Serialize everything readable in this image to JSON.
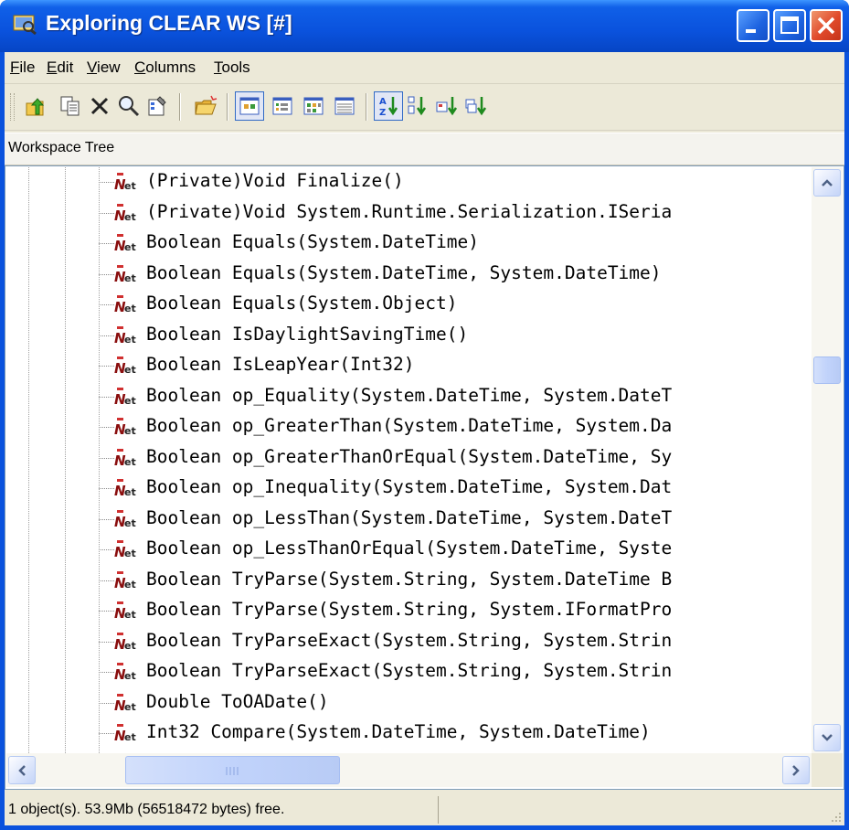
{
  "window": {
    "title": "Exploring CLEAR WS [#]"
  },
  "menu": [
    {
      "label": "File",
      "mnemonic": "F"
    },
    {
      "label": "Edit",
      "mnemonic": "E"
    },
    {
      "label": "View",
      "mnemonic": "V"
    },
    {
      "label": "Columns",
      "mnemonic": "C"
    },
    {
      "label": "Tools",
      "mnemonic": "T"
    }
  ],
  "toolbar": {
    "buttons": [
      {
        "name": "up-folder-icon"
      },
      {
        "name": "copy-icon"
      },
      {
        "name": "delete-icon"
      },
      {
        "name": "find-icon"
      },
      {
        "name": "properties-icon"
      },
      {
        "name": "open-folder-icon"
      },
      {
        "name": "large-icons-view-icon",
        "pressed": true
      },
      {
        "name": "small-icons-view-icon"
      },
      {
        "name": "list-view-icon"
      },
      {
        "name": "details-view-icon"
      },
      {
        "name": "sort-az-icon",
        "pressed": true
      },
      {
        "name": "sort-type-icon"
      },
      {
        "name": "sort-size-icon"
      },
      {
        "name": "sort-date-icon"
      }
    ]
  },
  "panel": {
    "header": "Workspace Tree"
  },
  "tree": {
    "items": [
      {
        "label": "(Private)Void Finalize()"
      },
      {
        "label": "(Private)Void System.Runtime.Serialization.ISeria"
      },
      {
        "label": "Boolean Equals(System.DateTime)"
      },
      {
        "label": "Boolean Equals(System.DateTime, System.DateTime)"
      },
      {
        "label": "Boolean Equals(System.Object)"
      },
      {
        "label": "Boolean IsDaylightSavingTime()"
      },
      {
        "label": "Boolean IsLeapYear(Int32)"
      },
      {
        "label": "Boolean op_Equality(System.DateTime, System.DateT"
      },
      {
        "label": "Boolean op_GreaterThan(System.DateTime, System.Da"
      },
      {
        "label": "Boolean op_GreaterThanOrEqual(System.DateTime, Sy"
      },
      {
        "label": "Boolean op_Inequality(System.DateTime, System.Dat"
      },
      {
        "label": "Boolean op_LessThan(System.DateTime, System.DateT"
      },
      {
        "label": "Boolean op_LessThanOrEqual(System.DateTime, Syste"
      },
      {
        "label": "Boolean TryParse(System.String, System.DateTime B"
      },
      {
        "label": "Boolean TryParse(System.String, System.IFormatPro"
      },
      {
        "label": "Boolean TryParseExact(System.String, System.Strin"
      },
      {
        "label": "Boolean TryParseExact(System.String, System.Strin"
      },
      {
        "label": "Double ToOADate()"
      },
      {
        "label": "Int32 Compare(System.DateTime, System.DateTime)"
      }
    ]
  },
  "scroll": {
    "vertical_position": 0.32,
    "horizontal_position": 0.0
  },
  "status": {
    "text": "1 object(s). 53.9Mb (56518472 bytes) free."
  },
  "colors": {
    "titlebar": "#0a52dd",
    "close_button": "#e0492a",
    "face": "#ece9d8"
  }
}
